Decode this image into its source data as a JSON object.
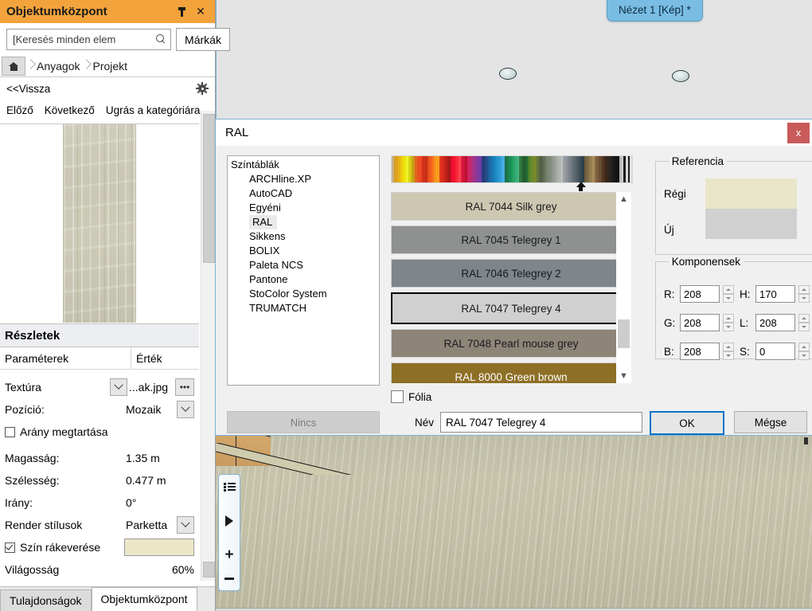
{
  "viewport": {
    "view_tab_label": "Nézet 1 [Kép] *",
    "tools": [
      {
        "name": "list-icon",
        "label": "list"
      },
      {
        "name": "play-icon",
        "label": "play"
      },
      {
        "name": "zoom-in-icon",
        "label": "+"
      },
      {
        "name": "zoom-out-icon",
        "label": "-"
      }
    ]
  },
  "left_panel": {
    "title": "Objektumközpont",
    "pin_label": "pin",
    "close_label": "✕",
    "search": {
      "value": "[Keresés minden elem",
      "placeholder": "[Keresés minden elemben]"
    },
    "brands_button": "Márkák",
    "breadcrumb": [
      "Anyagok",
      "Projekt"
    ],
    "back_label": "<<Vissza",
    "nav": [
      "Előző",
      "Következő",
      "Ugrás a kategóriára"
    ],
    "details": {
      "heading": "Részletek",
      "col_param": "Paraméterek",
      "col_value": "Érték",
      "rows": [
        {
          "label": "Textúra",
          "value": "...ak.jpg",
          "kind": "texture"
        },
        {
          "label": "Pozíció:",
          "value": "Mozaik",
          "kind": "dropdown"
        },
        {
          "label": "Arány megtartása",
          "value": "",
          "kind": "checkbox",
          "checked": false
        },
        {
          "label": "Magasság:",
          "value": "1.35 m",
          "kind": "text"
        },
        {
          "label": "Szélesség:",
          "value": "0.477 m",
          "kind": "text"
        },
        {
          "label": "Irány:",
          "value": "0°",
          "kind": "text"
        },
        {
          "label": "Render stílusok",
          "value": "Parketta",
          "kind": "dropdown"
        },
        {
          "label": "Szín rákeverése",
          "value": "",
          "kind": "checkbox-color",
          "checked": true,
          "color": "#ece6c8"
        },
        {
          "label": "Világosság",
          "value": "60%",
          "kind": "text"
        }
      ]
    },
    "tabs": [
      {
        "label": "Tulajdonságok",
        "active": false
      },
      {
        "label": "Objektumközpont",
        "active": true
      }
    ]
  },
  "dialog": {
    "title": "RAL",
    "close_label": "x",
    "palettes": {
      "header": "Színtáblák",
      "items": [
        "ARCHline.XP",
        "AutoCAD",
        "Egyéni",
        "RAL",
        "Sikkens",
        "BOLIX",
        "Paleta NCS",
        "Pantone",
        "StoColor System",
        "TRUMATCH"
      ],
      "selected": "RAL"
    },
    "none_button": "Nincs",
    "strip_marker_position_pct": 79,
    "strip_colors": [
      "#c8b184",
      "#d79b1f",
      "#e0a41c",
      "#e8b415",
      "#ecc60f",
      "#f0d90a",
      "#efe60b",
      "#eaf02c",
      "#d9d314",
      "#cbb512",
      "#c79a19",
      "#e2651c",
      "#e8511d",
      "#ef4c23",
      "#e23b1c",
      "#cf3119",
      "#c4301a",
      "#e84a18",
      "#f05a1e",
      "#f4701f",
      "#f78c1f",
      "#fa9d1c",
      "#f6a01d",
      "#e2341f",
      "#d72a1c",
      "#c62419",
      "#b51e17",
      "#a31a14",
      "#e60a2e",
      "#ef1130",
      "#f51a33",
      "#f92c3a",
      "#fa4450",
      "#e11c42",
      "#cf1539",
      "#b61230",
      "#d81e5b",
      "#c42a6c",
      "#b1307a",
      "#a0348a",
      "#8f3897",
      "#7e3ca2",
      "#6d3fa8",
      "#2a3b78",
      "#25417f",
      "#22508d",
      "#1f5f9b",
      "#1c6da8",
      "#1a7cb5",
      "#1787c2",
      "#2291cb",
      "#2e9bd4",
      "#3aa5dd",
      "#46afe6",
      "#1f6a45",
      "#1e7a4d",
      "#1d8a55",
      "#1c9a5d",
      "#2aa36a",
      "#38ac77",
      "#46b584",
      "#2f7b3e",
      "#2a6b36",
      "#25 5b2e",
      "#206b36",
      "#4a7d2c",
      "#5d8c2e",
      "#708b2c",
      "#7f8a2a",
      "#6b7b3a",
      "#5d6d3f",
      "#4f5f44",
      "#5c6b52",
      "#6a7760",
      "#78836e",
      "#7f8a7a",
      "#8a9186",
      "#959b92",
      "#9fa59d",
      "#a9afa8",
      "#b3b8b3",
      "#bdc1be",
      "#9aa0a6",
      "#8e949a",
      "#828a90",
      "#767f86",
      "#6a747c",
      "#5e6a72",
      "#525f68",
      "#46545e",
      "#3a4a54",
      "#2f404a",
      "#6b5a3a",
      "#7a6742",
      "#89744a",
      "#987f52",
      "#a78d5a",
      "#8a6a45",
      "#7b5c3c",
      "#6c4e33",
      "#5d402a",
      "#4e3221",
      "#3f2418",
      "#34281c",
      "#2a2420",
      "#201f1e",
      "#1a1a1a",
      "#141414",
      "#0e0e0e",
      "#b9b9b9",
      "#cfcfcf",
      "#1a1a1a",
      "#d6d6d6",
      "#1a1a1a",
      "#e0e0e0"
    ],
    "swatches": [
      {
        "name": "RAL 7044 Silk grey",
        "color": "#cdc7b2",
        "text": "#1a1a1a",
        "selected": false
      },
      {
        "name": "RAL 7045 Telegrey 1",
        "color": "#8f9191",
        "text": "#1a1a1a",
        "selected": false
      },
      {
        "name": "RAL 7046 Telegrey 2",
        "color": "#7e868c",
        "text": "#1a1a1a",
        "selected": false
      },
      {
        "name": "RAL 7047 Telegrey 4",
        "color": "#d0d0d0",
        "text": "#1a1a1a",
        "selected": true
      },
      {
        "name": "RAL 7048 Pearl mouse grey",
        "color": "#8e8579",
        "text": "#1a1a1a",
        "selected": false
      },
      {
        "name": "RAL 8000 Green brown",
        "color": "#8e6f26",
        "text": "#ffffff",
        "selected": false
      }
    ],
    "reference": {
      "legend": "Referencia",
      "old_label": "Régi",
      "new_label": "Új",
      "old_color": "#e9e5c8",
      "new_color": "#d0d0d0"
    },
    "components": {
      "legend": "Komponensek",
      "fields": [
        {
          "key": "R:",
          "value": "208"
        },
        {
          "key": "G:",
          "value": "208"
        },
        {
          "key": "B:",
          "value": "208"
        },
        {
          "key": "H:",
          "value": "170"
        },
        {
          "key": "L:",
          "value": "208"
        },
        {
          "key": "S:",
          "value": "0"
        }
      ]
    },
    "folia_label": "Fólia",
    "folia_checked": false,
    "name_label": "Név",
    "name_value": "RAL 7047 Telegrey 4",
    "ok_button": "OK",
    "cancel_button": "Mégse"
  }
}
